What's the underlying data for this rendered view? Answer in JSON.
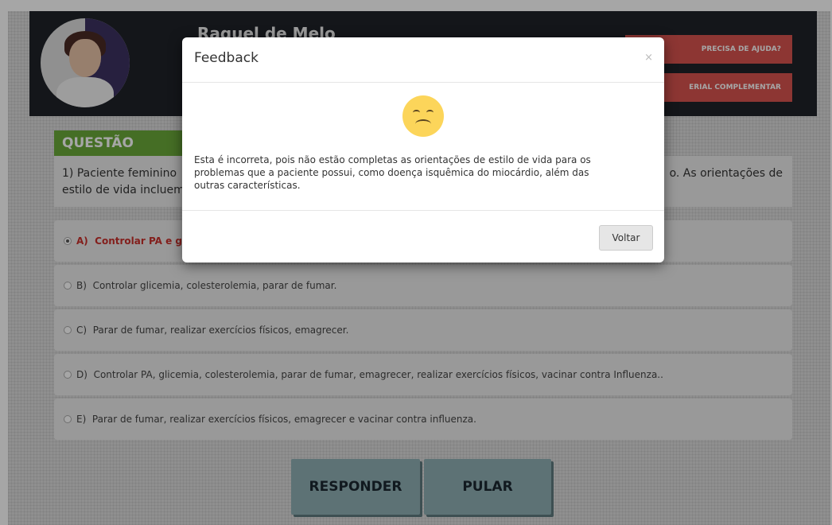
{
  "patient": {
    "name": "Raquel de Melo"
  },
  "help_buttons": {
    "help": "PRECISA DE AJUDA?",
    "material": "ERIAL COMPLEMENTAR"
  },
  "question": {
    "header": "QUESTÃO",
    "line1": "1) Paciente feminino",
    "line2": "estilo de vida incluem",
    "line3": "o. As orientações de"
  },
  "options": [
    {
      "letter": "A)",
      "text": "Controlar PA e gl",
      "selected": true
    },
    {
      "letter": "B)",
      "text": "Controlar glicemia, colesterolemia, parar de fumar.",
      "selected": false
    },
    {
      "letter": "C)",
      "text": "Parar de fumar, realizar exercícios físicos, emagrecer.",
      "selected": false
    },
    {
      "letter": "D)",
      "text": "Controlar PA, glicemia, colesterolemia, parar de fumar, emagrecer, realizar exercícios físicos, vacinar contra Influenza..",
      "selected": false
    },
    {
      "letter": "E)",
      "text": "Parar de fumar, realizar exercícios físicos, emagrecer e vacinar contra influenza.",
      "selected": false
    }
  ],
  "actions": {
    "respond": "RESPONDER",
    "skip": "PULAR"
  },
  "modal": {
    "title": "Feedback",
    "close": "×",
    "emoji_icon": "sad-face-icon",
    "message_line1": "Esta é incorreta, pois não estão completas as orientações de estilo de vida para os",
    "message_line2": "problemas que a paciente possui, como doença isquêmica do miocárdio, além das",
    "message_line3": "outras características.",
    "back_button": "Voltar"
  },
  "colors": {
    "topbar": "#1f2329",
    "question_header": "#6aaa3a",
    "help_button": "#d9534f",
    "selected_option": "#c9302c",
    "action_button": "#8fb0b4"
  }
}
